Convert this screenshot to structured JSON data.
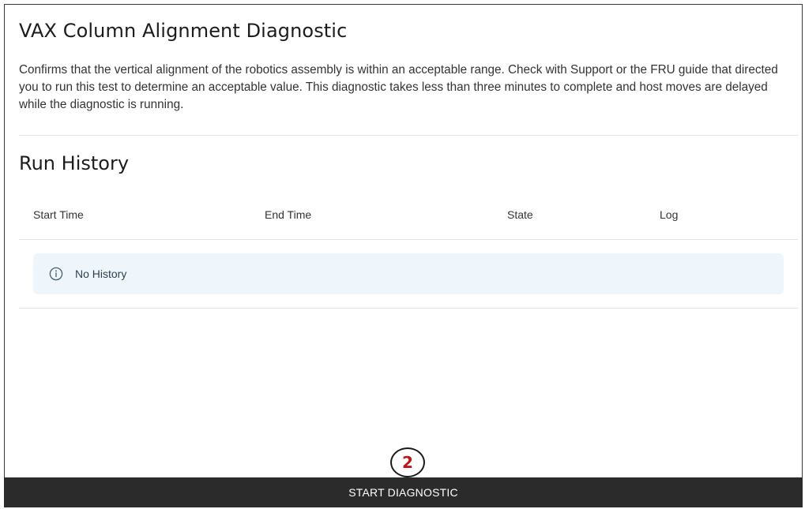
{
  "diagnostic": {
    "title": "VAX Column Alignment Diagnostic",
    "description": "Confirms that the vertical alignment of the robotics assembly is within an acceptable range. Check with Support or the FRU guide that directed you to run this test to determine an acceptable value. This diagnostic takes less than three minutes to complete and host moves are delayed while the diagnostic is running."
  },
  "run_history": {
    "title": "Run History",
    "columns": [
      "Start Time",
      "End Time",
      "State",
      "Log"
    ],
    "empty_message": "No History",
    "empty_icon": "info-circle-icon",
    "empty_background": "#eef6fb"
  },
  "step_marker": {
    "number": "2",
    "color": "#c0131a"
  },
  "actions": {
    "start_label": "START DIAGNOSTIC",
    "button_color": "#2b2b2b"
  }
}
